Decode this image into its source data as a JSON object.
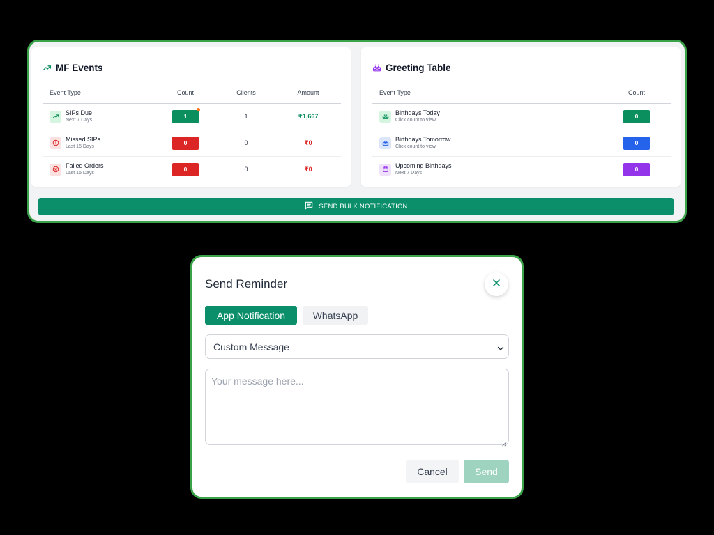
{
  "mf_events": {
    "title": "MF Events",
    "headers": {
      "event_type": "Event Type",
      "count": "Count",
      "clients": "Clients",
      "amount": "Amount"
    },
    "rows": [
      {
        "name": "SIPs Due",
        "sub": "Next 7 Days",
        "count": "1",
        "clients": "1",
        "amount": "₹1,667",
        "icon": "trend-up-icon",
        "color": "#0b8f5e"
      },
      {
        "name": "Missed SIPs",
        "sub": "Last 15 Days",
        "count": "0",
        "clients": "0",
        "amount": "₹0",
        "icon": "alert-circle-icon",
        "color": "#dc2626"
      },
      {
        "name": "Failed Orders",
        "sub": "Last 15 Days",
        "count": "0",
        "clients": "0",
        "amount": "₹0",
        "icon": "x-circle-icon",
        "color": "#dc2626"
      }
    ]
  },
  "greeting_table": {
    "title": "Greeting Table",
    "headers": {
      "event_type": "Event Type",
      "count": "Count"
    },
    "rows": [
      {
        "name": "Birthdays Today",
        "sub": "Click count to view",
        "count": "0",
        "icon": "cake-icon",
        "color": "#0b8f5e"
      },
      {
        "name": "Birthdays Tomorrow",
        "sub": "Click count to view",
        "count": "0",
        "icon": "cake-icon",
        "color": "#2563eb"
      },
      {
        "name": "Upcoming Birthdays",
        "sub": "Next 7 Days",
        "count": "0",
        "icon": "calendar-icon",
        "color": "#9333ea"
      }
    ]
  },
  "bulk_button": {
    "label": "SEND BULK NOTIFICATION",
    "icon": "message-square-icon"
  },
  "modal": {
    "title": "Send Reminder",
    "close_icon": "close-icon",
    "tabs": [
      {
        "label": "App Notification",
        "active": true
      },
      {
        "label": "WhatsApp",
        "active": false
      }
    ],
    "select_value": "Custom Message",
    "message_placeholder": "Your message here...",
    "cancel_label": "Cancel",
    "send_label": "Send"
  },
  "colors": {
    "brand_green": "#0b8f6b",
    "frame_green": "#3aa34a",
    "danger_red": "#dc2626",
    "blue": "#2563eb",
    "purple": "#9333ea",
    "send_disabled": "#9ed4bf"
  }
}
